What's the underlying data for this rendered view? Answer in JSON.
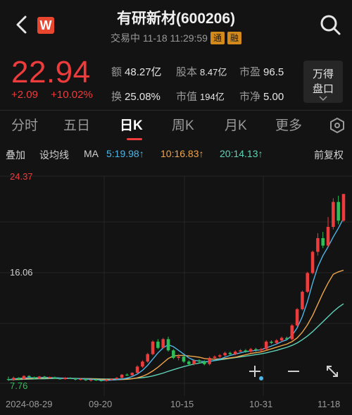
{
  "header": {
    "title": "有研新材(600206)",
    "status": "交易中 11-18 11:29:59",
    "tags": [
      "通",
      "融"
    ],
    "logo_letter": "W"
  },
  "quote": {
    "price": "22.94",
    "change": "+2.09",
    "change_pct": "+10.02%",
    "stats": [
      {
        "label": "额",
        "value": "48.27亿"
      },
      {
        "label": "股本",
        "value": "8.47亿"
      },
      {
        "label": "市盈",
        "value": "96.5"
      },
      {
        "label": "换",
        "value": "25.08%"
      },
      {
        "label": "市值",
        "value": "194亿"
      },
      {
        "label": "市净",
        "value": "5.00"
      }
    ],
    "button": {
      "line1": "万得",
      "line2": "盘口"
    }
  },
  "tabs": [
    "分时",
    "五日",
    "日K",
    "周K",
    "月K",
    "更多"
  ],
  "active_tab": "日K",
  "indicators": {
    "overlay": "叠加",
    "set_ma": "设均线",
    "ma": "MA",
    "ma5": "5:19.98↑",
    "ma10": "10:16.83↑",
    "ma20": "20:14.13↑",
    "adjust": "前复权"
  },
  "colors": {
    "up": "#ee3b3b",
    "down": "#2fbf5a",
    "ma5": "#4fb6e8",
    "ma10": "#f0a64a",
    "ma20": "#5fd3b7"
  },
  "chart_data": {
    "type": "candlestick",
    "y_max_label": "24.37",
    "y_mid_label": "16.06",
    "y_min_label": "7.76",
    "ylim": [
      7.76,
      24.37
    ],
    "x_labels": [
      "2024-08-29",
      "09-20",
      "10-15",
      "10-31",
      "11-18"
    ],
    "candles": [
      [
        8.1,
        8.05,
        8.3,
        7.95
      ],
      [
        8.05,
        8.2,
        8.3,
        7.95
      ],
      [
        8.2,
        8.1,
        8.25,
        8.0
      ],
      [
        8.1,
        8.35,
        8.4,
        8.05
      ],
      [
        8.35,
        8.25,
        8.4,
        8.15
      ],
      [
        8.25,
        8.15,
        8.3,
        8.1
      ],
      [
        8.15,
        8.3,
        8.35,
        8.1
      ],
      [
        8.3,
        8.2,
        8.35,
        8.15
      ],
      [
        8.2,
        8.25,
        8.3,
        8.15
      ],
      [
        8.25,
        8.15,
        8.3,
        8.1
      ],
      [
        8.15,
        8.1,
        8.2,
        8.05
      ],
      [
        8.1,
        8.2,
        8.25,
        8.05
      ],
      [
        8.2,
        8.15,
        8.25,
        8.1
      ],
      [
        8.15,
        8.05,
        8.2,
        8.0
      ],
      [
        8.05,
        8.1,
        8.15,
        8.0
      ],
      [
        8.1,
        8.0,
        8.15,
        7.95
      ],
      [
        8.0,
        8.05,
        8.1,
        7.9
      ],
      [
        8.05,
        8.0,
        8.1,
        7.95
      ],
      [
        8.0,
        7.95,
        8.05,
        7.9
      ],
      [
        7.95,
        8.05,
        8.1,
        7.9
      ],
      [
        8.05,
        8.1,
        8.15,
        8.0
      ],
      [
        8.1,
        8.2,
        8.25,
        8.05
      ],
      [
        8.2,
        8.45,
        8.5,
        8.15
      ],
      [
        8.45,
        8.4,
        8.55,
        8.35
      ],
      [
        8.4,
        8.6,
        8.65,
        8.35
      ],
      [
        8.6,
        9.1,
        9.2,
        8.55
      ],
      [
        9.1,
        9.5,
        9.6,
        9.0
      ],
      [
        9.5,
        10.1,
        10.2,
        9.4
      ],
      [
        10.1,
        11.1,
        11.2,
        10.0
      ],
      [
        11.1,
        10.6,
        11.3,
        10.5
      ],
      [
        10.6,
        11.3,
        11.4,
        10.5
      ],
      [
        11.3,
        10.4,
        11.5,
        10.3
      ],
      [
        10.4,
        9.8,
        10.5,
        9.7
      ],
      [
        9.8,
        9.9,
        10.1,
        9.6
      ],
      [
        9.9,
        9.5,
        10.0,
        9.4
      ],
      [
        9.5,
        9.3,
        9.6,
        9.2
      ],
      [
        9.3,
        9.6,
        9.7,
        9.2
      ],
      [
        9.6,
        9.5,
        9.7,
        9.4
      ],
      [
        9.5,
        9.3,
        9.6,
        9.2
      ],
      [
        9.3,
        9.8,
        9.9,
        9.2
      ],
      [
        9.8,
        9.9,
        10.0,
        9.7
      ],
      [
        9.9,
        10.0,
        10.1,
        9.8
      ],
      [
        10.0,
        10.2,
        10.3,
        9.9
      ],
      [
        10.2,
        10.1,
        10.3,
        10.0
      ],
      [
        10.1,
        10.3,
        10.4,
        10.0
      ],
      [
        10.3,
        10.4,
        10.5,
        10.2
      ],
      [
        10.4,
        10.3,
        10.5,
        10.2
      ],
      [
        10.3,
        10.5,
        10.6,
        10.2
      ],
      [
        10.5,
        10.4,
        10.6,
        10.3
      ],
      [
        10.4,
        10.5,
        10.6,
        10.3
      ],
      [
        10.5,
        11.1,
        11.2,
        10.4
      ],
      [
        11.1,
        11.0,
        11.2,
        10.9
      ],
      [
        11.0,
        11.2,
        11.3,
        10.9
      ],
      [
        11.2,
        11.4,
        11.5,
        11.1
      ],
      [
        11.4,
        11.3,
        11.5,
        11.2
      ],
      [
        11.3,
        12.4,
        12.5,
        11.2
      ],
      [
        12.4,
        13.7,
        13.8,
        12.3
      ],
      [
        13.7,
        15.1,
        15.2,
        13.6
      ],
      [
        15.1,
        16.6,
        16.7,
        15.0
      ],
      [
        16.6,
        18.3,
        18.4,
        16.5
      ],
      [
        18.3,
        19.4,
        19.8,
        18.0
      ],
      [
        19.4,
        18.8,
        19.9,
        18.6
      ],
      [
        18.8,
        20.3,
        21.1,
        18.7
      ],
      [
        20.3,
        22.3,
        22.6,
        20.1
      ],
      [
        22.3,
        20.8,
        22.8,
        20.5
      ],
      [
        20.8,
        22.94,
        22.94,
        20.7
      ]
    ],
    "ma5": [
      8.05,
      8.1,
      8.15,
      8.18,
      8.2,
      8.2,
      8.22,
      8.23,
      8.22,
      8.2,
      8.18,
      8.17,
      8.16,
      8.14,
      8.12,
      8.1,
      8.08,
      8.06,
      8.02,
      8.0,
      8.02,
      8.05,
      8.1,
      8.18,
      8.3,
      8.5,
      8.8,
      9.2,
      9.7,
      10.2,
      10.6,
      10.85,
      10.7,
      10.4,
      10.1,
      9.8,
      9.6,
      9.55,
      9.5,
      9.5,
      9.6,
      9.7,
      9.85,
      10.0,
      10.1,
      10.2,
      10.3,
      10.35,
      10.4,
      10.45,
      10.6,
      10.75,
      10.9,
      11.1,
      11.25,
      11.6,
      12.2,
      13.1,
      14.3,
      15.8,
      17.1,
      18.0,
      18.7,
      19.5,
      20.2,
      21.0
    ],
    "ma10": [
      8.05,
      8.07,
      8.1,
      8.12,
      8.14,
      8.15,
      8.17,
      8.18,
      8.19,
      8.19,
      8.18,
      8.17,
      8.16,
      8.15,
      8.14,
      8.13,
      8.12,
      8.1,
      8.08,
      8.06,
      8.05,
      8.05,
      8.06,
      8.08,
      8.12,
      8.2,
      8.32,
      8.5,
      8.75,
      9.05,
      9.4,
      9.75,
      9.95,
      10.0,
      10.0,
      9.95,
      9.9,
      9.85,
      9.75,
      9.7,
      9.7,
      9.72,
      9.75,
      9.8,
      9.85,
      9.95,
      10.05,
      10.15,
      10.22,
      10.28,
      10.4,
      10.52,
      10.65,
      10.78,
      10.9,
      11.1,
      11.4,
      11.85,
      12.45,
      13.2,
      14.1,
      15.0,
      15.8,
      16.5,
      16.7,
      16.83
    ],
    "ma20": [
      8.05,
      8.06,
      8.07,
      8.08,
      8.1,
      8.11,
      8.12,
      8.13,
      8.14,
      8.15,
      8.15,
      8.15,
      8.15,
      8.14,
      8.14,
      8.13,
      8.13,
      8.12,
      8.11,
      8.1,
      8.1,
      8.1,
      8.11,
      8.12,
      8.14,
      8.17,
      8.21,
      8.27,
      8.35,
      8.46,
      8.58,
      8.72,
      8.85,
      8.98,
      9.1,
      9.2,
      9.3,
      9.38,
      9.45,
      9.52,
      9.58,
      9.64,
      9.7,
      9.76,
      9.82,
      9.88,
      9.94,
      10.0,
      10.06,
      10.12,
      10.2,
      10.3,
      10.4,
      10.52,
      10.64,
      10.8,
      11.0,
      11.25,
      11.55,
      11.9,
      12.3,
      12.7,
      13.1,
      13.5,
      13.85,
      14.13
    ]
  }
}
